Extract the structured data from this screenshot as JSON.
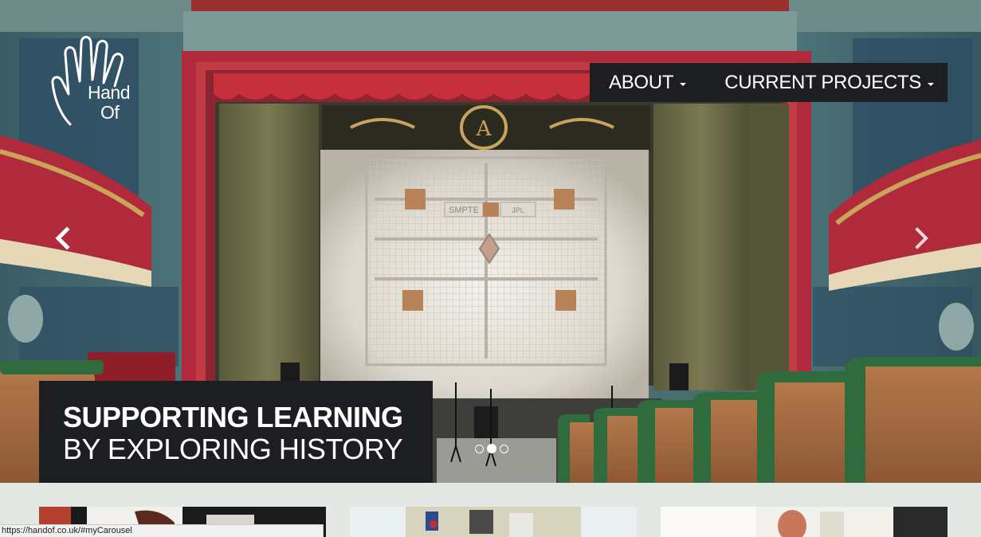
{
  "logo": {
    "line1": "Hand",
    "line2": "Of"
  },
  "nav": {
    "items": [
      {
        "label": "ABOUT"
      },
      {
        "label": "CURRENT PROJECTS"
      }
    ]
  },
  "carousel": {
    "prev_icon": "chevron-left-icon",
    "next_icon": "chevron-right-icon",
    "caption": {
      "line1": "SUPPORTING LEARNING",
      "line2": "BY EXPLORING HISTORY"
    },
    "slide_count": 3,
    "active_slide": 2,
    "screen_label_left": "SMPTE",
    "screen_label_right": "JPL",
    "proscenium_letter": "A"
  },
  "status_bar": {
    "url": "https://handof.co.uk/#myCarousel"
  },
  "colors": {
    "nav_bg": "#1d1e22",
    "caption_bg": "#1d1e22",
    "page_bg": "#e4e8e4",
    "curtain_red": "#b02a3c",
    "seat_green": "#2f6b3c"
  }
}
